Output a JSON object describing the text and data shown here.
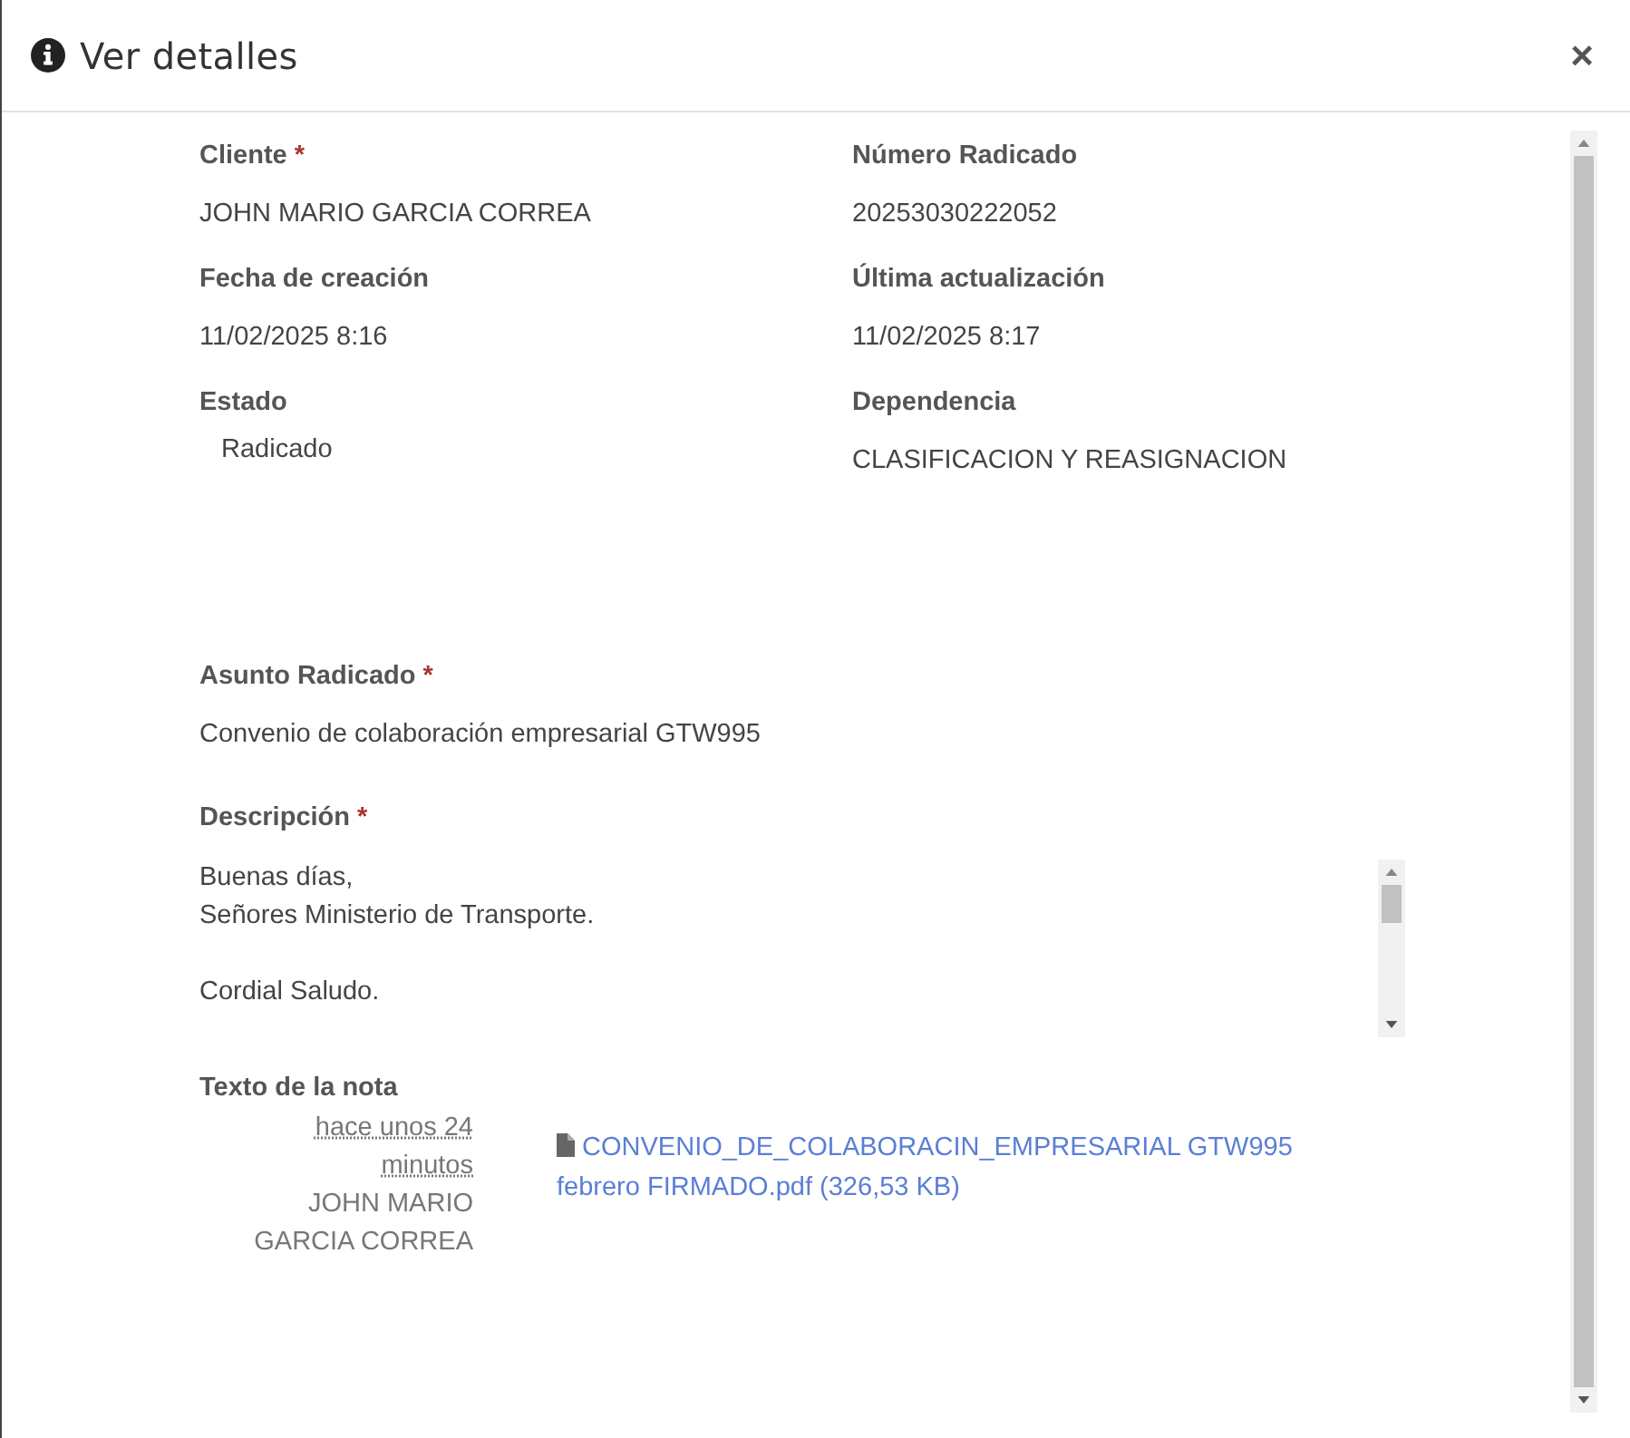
{
  "window": {
    "title": "Ver detalles",
    "close": "×"
  },
  "fields": [
    {
      "label": "Cliente",
      "required_mark": "*",
      "value": "JOHN MARIO GARCIA CORREA",
      "kind": "text"
    },
    {
      "label": "Número Radicado",
      "value": "20253030222052",
      "kind": "text"
    },
    {
      "label": "Fecha de creación",
      "value": "11/02/2025 8:16",
      "kind": "text"
    },
    {
      "label": "Última actualización",
      "value": "11/02/2025 8:17",
      "kind": "text"
    },
    {
      "label": "Estado",
      "value": "Radicado",
      "kind": "status"
    },
    {
      "label": "Dependencia",
      "value": "CLASIFICACION Y REASIGNACION",
      "kind": "text"
    }
  ],
  "subject": {
    "label": "Asunto Radicado",
    "required_mark": "*",
    "value": "Convenio de colaboración empresarial GTW995"
  },
  "description": {
    "label": "Descripción",
    "required_mark": "*",
    "paragraphs": [
      [
        "Buenas días,",
        "Señores Ministerio de Transporte."
      ],
      [
        "Cordial Saludo."
      ]
    ]
  },
  "note": {
    "label": "Texto de la nota",
    "time": "hace unos 24 minutos",
    "author": "JOHN MARIO GARCIA CORREA",
    "attachment": "CONVENIO_DE_COLABORACIN_EMPRESARIAL GTW995 febrero FIRMADO.pdf (326,53 KB)"
  }
}
